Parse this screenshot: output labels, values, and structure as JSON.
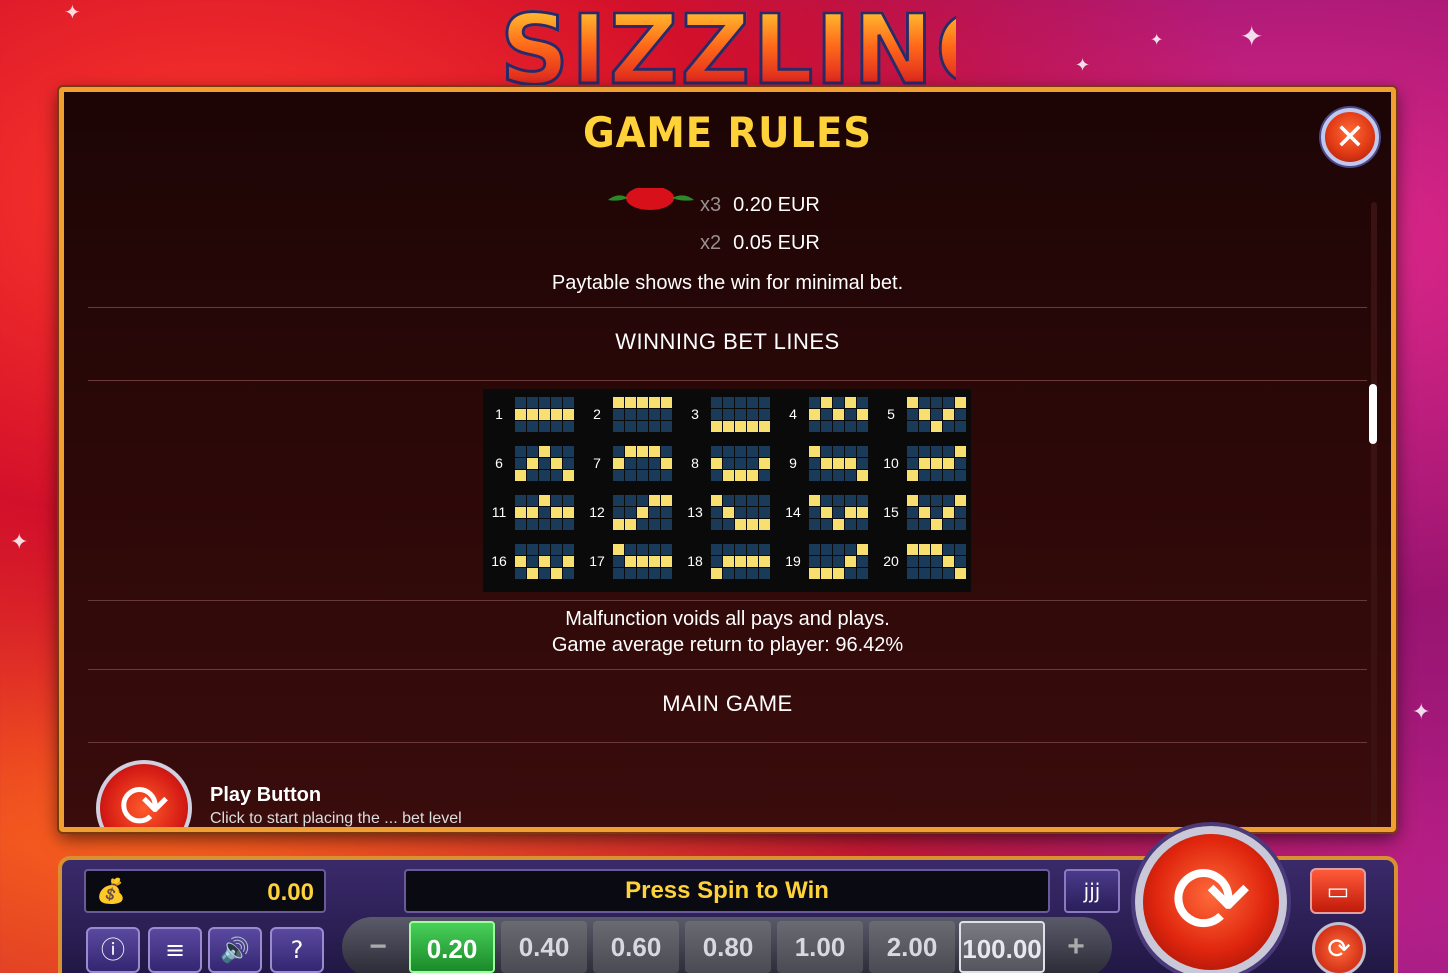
{
  "logo_text": "SIZZLING",
  "modal": {
    "title": "GAME RULES",
    "close_label": "✕"
  },
  "paytable": {
    "rows": [
      {
        "mult": "x3",
        "value": "0.20 EUR"
      },
      {
        "mult": "x2",
        "value": "0.05 EUR"
      }
    ],
    "note": "Paytable shows the win for minimal bet."
  },
  "winning_bet_lines": {
    "title": "WINNING BET LINES",
    "lines": [
      {
        "n": "1",
        "rows": [
          [
            0,
            0,
            0,
            0,
            0
          ],
          [
            1,
            1,
            1,
            1,
            1
          ],
          [
            0,
            0,
            0,
            0,
            0
          ]
        ]
      },
      {
        "n": "2",
        "rows": [
          [
            1,
            1,
            1,
            1,
            1
          ],
          [
            0,
            0,
            0,
            0,
            0
          ],
          [
            0,
            0,
            0,
            0,
            0
          ]
        ]
      },
      {
        "n": "3",
        "rows": [
          [
            0,
            0,
            0,
            0,
            0
          ],
          [
            0,
            0,
            0,
            0,
            0
          ],
          [
            1,
            1,
            1,
            1,
            1
          ]
        ]
      },
      {
        "n": "4",
        "rows": [
          [
            0,
            1,
            0,
            1,
            0
          ],
          [
            1,
            0,
            1,
            0,
            1
          ],
          [
            0,
            0,
            0,
            0,
            0
          ]
        ]
      },
      {
        "n": "5",
        "rows": [
          [
            1,
            0,
            0,
            0,
            1
          ],
          [
            0,
            1,
            0,
            1,
            0
          ],
          [
            0,
            0,
            1,
            0,
            0
          ]
        ]
      },
      {
        "n": "6",
        "rows": [
          [
            0,
            0,
            1,
            0,
            0
          ],
          [
            0,
            1,
            0,
            1,
            0
          ],
          [
            1,
            0,
            0,
            0,
            1
          ]
        ]
      },
      {
        "n": "7",
        "rows": [
          [
            0,
            1,
            1,
            1,
            0
          ],
          [
            1,
            0,
            0,
            0,
            1
          ],
          [
            0,
            0,
            0,
            0,
            0
          ]
        ]
      },
      {
        "n": "8",
        "rows": [
          [
            0,
            0,
            0,
            0,
            0
          ],
          [
            1,
            0,
            0,
            0,
            1
          ],
          [
            0,
            1,
            1,
            1,
            0
          ]
        ]
      },
      {
        "n": "9",
        "rows": [
          [
            1,
            0,
            0,
            0,
            0
          ],
          [
            0,
            1,
            1,
            1,
            0
          ],
          [
            0,
            0,
            0,
            0,
            1
          ]
        ]
      },
      {
        "n": "10",
        "rows": [
          [
            0,
            0,
            0,
            0,
            1
          ],
          [
            0,
            1,
            1,
            1,
            0
          ],
          [
            1,
            0,
            0,
            0,
            0
          ]
        ]
      },
      {
        "n": "11",
        "rows": [
          [
            0,
            0,
            1,
            0,
            0
          ],
          [
            1,
            1,
            0,
            1,
            1
          ],
          [
            0,
            0,
            0,
            0,
            0
          ]
        ]
      },
      {
        "n": "12",
        "rows": [
          [
            0,
            0,
            0,
            1,
            1
          ],
          [
            0,
            0,
            1,
            0,
            0
          ],
          [
            1,
            1,
            0,
            0,
            0
          ]
        ]
      },
      {
        "n": "13",
        "rows": [
          [
            1,
            0,
            0,
            0,
            0
          ],
          [
            0,
            1,
            0,
            0,
            0
          ],
          [
            0,
            0,
            1,
            1,
            1
          ]
        ]
      },
      {
        "n": "14",
        "rows": [
          [
            1,
            0,
            0,
            0,
            0
          ],
          [
            0,
            1,
            0,
            1,
            1
          ],
          [
            0,
            0,
            1,
            0,
            0
          ]
        ]
      },
      {
        "n": "15",
        "rows": [
          [
            1,
            0,
            0,
            0,
            1
          ],
          [
            0,
            1,
            0,
            1,
            0
          ],
          [
            0,
            0,
            1,
            0,
            0
          ]
        ]
      },
      {
        "n": "16",
        "rows": [
          [
            0,
            0,
            0,
            0,
            0
          ],
          [
            1,
            0,
            1,
            0,
            1
          ],
          [
            0,
            1,
            0,
            1,
            0
          ]
        ]
      },
      {
        "n": "17",
        "rows": [
          [
            1,
            0,
            0,
            0,
            0
          ],
          [
            0,
            1,
            1,
            1,
            1
          ],
          [
            0,
            0,
            0,
            0,
            0
          ]
        ]
      },
      {
        "n": "18",
        "rows": [
          [
            0,
            0,
            0,
            0,
            0
          ],
          [
            0,
            1,
            1,
            1,
            1
          ],
          [
            1,
            0,
            0,
            0,
            0
          ]
        ]
      },
      {
        "n": "19",
        "rows": [
          [
            0,
            0,
            0,
            0,
            1
          ],
          [
            0,
            0,
            0,
            1,
            0
          ],
          [
            1,
            1,
            1,
            0,
            0
          ]
        ]
      },
      {
        "n": "20",
        "rows": [
          [
            1,
            1,
            1,
            0,
            0
          ],
          [
            0,
            0,
            0,
            1,
            0
          ],
          [
            0,
            0,
            0,
            0,
            1
          ]
        ]
      }
    ]
  },
  "info": {
    "line1": "Malfunction voids all pays and plays.",
    "line2": "Game average return to player: 96.42%"
  },
  "main_game": {
    "title": "MAIN GAME",
    "play_button_label": "Play Button",
    "play_button_desc": "Click to start placing the ... bet level"
  },
  "console": {
    "balance": "0.00",
    "message": "Press Spin to Win",
    "bets": [
      "0.20",
      "0.40",
      "0.60",
      "0.80",
      "1.00",
      "2.00",
      "100.00"
    ],
    "active_bet": "0.20",
    "minus": "−",
    "plus": "+"
  },
  "colors": {
    "accent_gold": "#ffd23a",
    "frame_orange": "#f0a030",
    "active_bet_green": "#2aa83a",
    "line_on": "#f8e070",
    "line_off": "#1a3a5a"
  },
  "icons": [
    "money-bag-icon",
    "info-icon",
    "menu-icon",
    "sound-icon",
    "help-icon",
    "chili-icon",
    "spin-icon",
    "turbo-icon",
    "autoplay-icon",
    "close-icon"
  ]
}
